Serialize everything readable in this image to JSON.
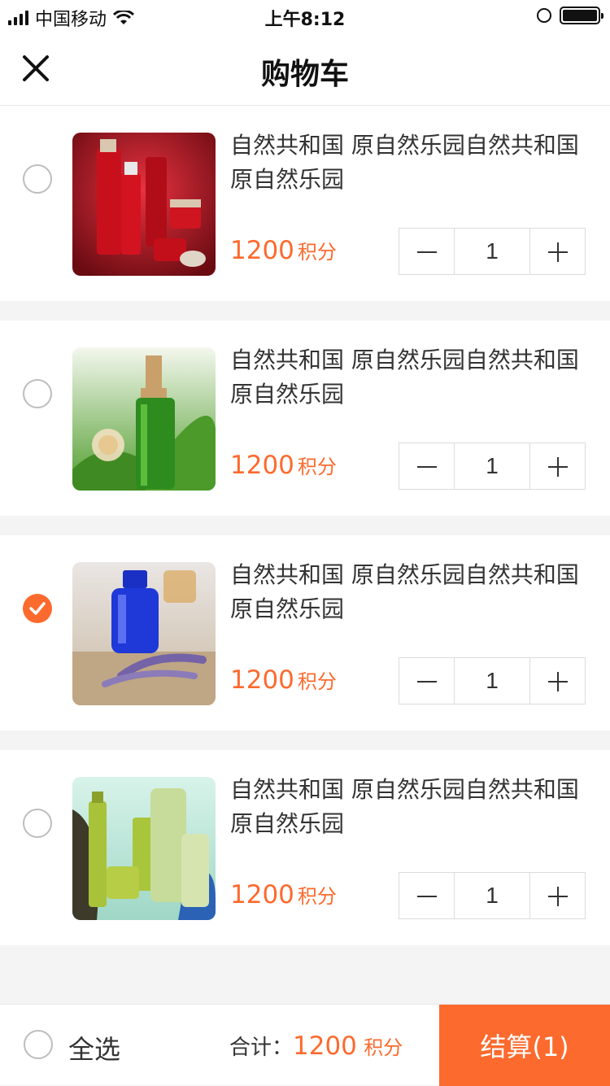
{
  "status_bar": {
    "carrier": "中国移动",
    "time": "上午8:12"
  },
  "nav": {
    "title": "购物车"
  },
  "items": [
    {
      "name": "自然共和国 原自然乐园自然共和国原自然乐园",
      "price": "1200",
      "unit": "积分",
      "qty": "1",
      "checked": false
    },
    {
      "name": "自然共和国 原自然乐园自然共和国原自然乐园",
      "price": "1200",
      "unit": "积分",
      "qty": "1",
      "checked": false
    },
    {
      "name": "自然共和国 原自然乐园自然共和国原自然乐园",
      "price": "1200",
      "unit": "积分",
      "qty": "1",
      "checked": true
    },
    {
      "name": "自然共和国 原自然乐园自然共和国原自然乐园",
      "price": "1200",
      "unit": "积分",
      "qty": "1",
      "checked": false
    }
  ],
  "footer": {
    "select_all": "全选",
    "total_label": "合计：",
    "total_value": "1200",
    "total_unit": "积分",
    "checkout": "结算(1)"
  },
  "colors": {
    "accent": "#fd6a2e",
    "background": "#f4f4f4"
  }
}
